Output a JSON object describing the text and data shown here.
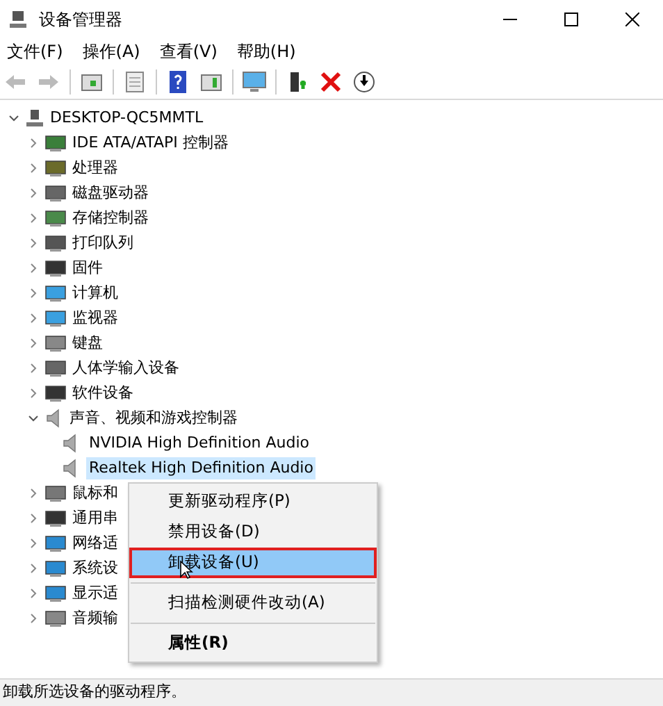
{
  "window": {
    "title": "设备管理器"
  },
  "menu_bar": [
    "文件(F)",
    "操作(A)",
    "查看(V)",
    "帮助(H)"
  ],
  "tree": {
    "label": "DESKTOP-QC5MMTL",
    "expanded": true,
    "children": [
      {
        "label": "IDE ATA/ATAPI 控制器",
        "expanded": false
      },
      {
        "label": "处理器",
        "expanded": false
      },
      {
        "label": "磁盘驱动器",
        "expanded": false
      },
      {
        "label": "存储控制器",
        "expanded": false
      },
      {
        "label": "打印队列",
        "expanded": false
      },
      {
        "label": "固件",
        "expanded": false
      },
      {
        "label": "计算机",
        "expanded": false
      },
      {
        "label": "监视器",
        "expanded": false
      },
      {
        "label": "键盘",
        "expanded": false
      },
      {
        "label": "人体学输入设备",
        "expanded": false
      },
      {
        "label": "软件设备",
        "expanded": false
      },
      {
        "label": "声音、视频和游戏控制器",
        "expanded": true,
        "children": [
          {
            "label": "NVIDIA High Definition Audio",
            "selected": false
          },
          {
            "label": "Realtek High Definition Audio",
            "selected": true
          }
        ]
      },
      {
        "label": "鼠标和",
        "expanded": false
      },
      {
        "label": "通用串",
        "expanded": false
      },
      {
        "label": "网络适",
        "expanded": false
      },
      {
        "label": "系统设",
        "expanded": false
      },
      {
        "label": "显示适",
        "expanded": false
      },
      {
        "label": "音频输",
        "expanded": false
      }
    ]
  },
  "context_menu": [
    {
      "kind": "item",
      "label": "更新驱动程序(P)",
      "selected": false
    },
    {
      "kind": "item",
      "label": "禁用设备(D)",
      "selected": false
    },
    {
      "kind": "item",
      "label": "卸载设备(U)",
      "selected": true
    },
    {
      "kind": "separator"
    },
    {
      "kind": "item",
      "label": "扫描检测硬件改动(A)",
      "selected": false
    },
    {
      "kind": "separator"
    },
    {
      "kind": "default",
      "label": "属性(R)",
      "selected": false
    }
  ],
  "status_bar": "卸载所选设备的驱动程序。"
}
